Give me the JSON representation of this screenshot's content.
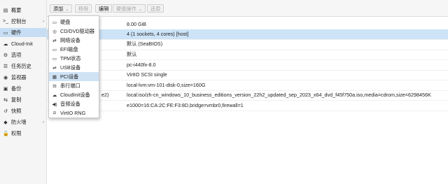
{
  "sidebar": {
    "items": [
      {
        "label": "概要",
        "icon": "summary-icon",
        "glyph": "▤"
      },
      {
        "label": "控制台",
        "icon": "console-icon",
        "glyph": ">_"
      },
      {
        "label": "硬件",
        "icon": "monitor-icon",
        "glyph": "▭"
      },
      {
        "label": "Cloud-Init",
        "icon": "cloud-icon",
        "glyph": "☁"
      },
      {
        "label": "选项",
        "icon": "gear-icon",
        "glyph": "⚙"
      },
      {
        "label": "任务历史",
        "icon": "list-icon",
        "glyph": "☰"
      },
      {
        "label": "监视器",
        "icon": "eye-icon",
        "glyph": "◉"
      },
      {
        "label": "备份",
        "icon": "save-icon",
        "glyph": "▣"
      },
      {
        "label": "复制",
        "icon": "retweet-icon",
        "glyph": "⇆"
      },
      {
        "label": "快照",
        "icon": "history-icon",
        "glyph": "↺"
      },
      {
        "label": "防火墙",
        "icon": "shield-icon",
        "glyph": "◆"
      },
      {
        "label": "权限",
        "icon": "unlock-icon",
        "glyph": "🔓"
      }
    ]
  },
  "toolbar": {
    "add_label": "添加",
    "remove_label": "移除",
    "edit_label": "编辑",
    "disk_action_label": "硬盘操作",
    "revert_label": "还原"
  },
  "grid": {
    "rows": [
      {
        "name": "",
        "value": "8.00 GiB"
      },
      {
        "name": "",
        "value": "4 (1 sockets, 4 cores) [host]"
      },
      {
        "name": "",
        "value": "默认 (SeaBIOS)"
      },
      {
        "name": "",
        "value": "默认"
      },
      {
        "name": "",
        "value": "pc-i440fx-8.0"
      },
      {
        "name": "",
        "value": "VirtIO SCSI single"
      },
      {
        "name": "",
        "value": "local-lvm:vm-101-disk-0,size=160G"
      },
      {
        "name": "e2)",
        "value": "local:iso/zh-cn_windows_10_business_editions_version_22h2_updated_sep_2023_x64_dvd_f45f750a.iso,media=cdrom,size=6298456K"
      },
      {
        "name": "",
        "value": "e1000=16:CA:2C:FE:F3:8D,bridge=vmbr0,firewall=1"
      }
    ]
  },
  "menu": {
    "items": [
      {
        "label": "硬盘",
        "icon": "hdd-icon",
        "glyph": "▭"
      },
      {
        "label": "CD/DVD驱动器",
        "icon": "cdrom-icon",
        "glyph": "◎"
      },
      {
        "label": "网络设备",
        "icon": "exchange-icon",
        "glyph": "⇄"
      },
      {
        "label": "EFI磁盘",
        "icon": "efi-disk-icon",
        "glyph": "▭"
      },
      {
        "label": "TPM状态",
        "icon": "tpm-icon",
        "glyph": "▭"
      },
      {
        "label": "USB设备",
        "icon": "usb-icon",
        "glyph": "⇌"
      },
      {
        "label": "PCI设备",
        "icon": "pci-icon",
        "glyph": "▦"
      },
      {
        "label": "串行端口",
        "icon": "serial-port-icon",
        "glyph": "⊟"
      },
      {
        "label": "CloudInit设备",
        "icon": "cloud-icon",
        "glyph": "☁"
      },
      {
        "label": "音频设备",
        "icon": "volume-icon",
        "glyph": "◀)"
      },
      {
        "label": "VirtIO RNG",
        "icon": "rng-icon",
        "glyph": "⧄"
      }
    ],
    "highlighted_index": 6
  }
}
